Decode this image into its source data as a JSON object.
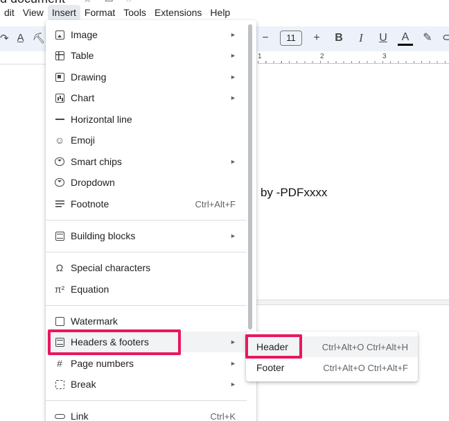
{
  "window": {
    "doc_title": "d document"
  },
  "menubar": {
    "items": [
      "dit",
      "View",
      "Insert",
      "Format",
      "Tools",
      "Extensions",
      "Help"
    ],
    "active": "Insert"
  },
  "toolbar": {
    "font_size": "11",
    "minus": "−",
    "plus": "+",
    "bold": "B",
    "italic": "I",
    "underline": "U",
    "text_color": "A"
  },
  "ruler": {
    "marks": [
      "1",
      "2",
      "3"
    ]
  },
  "document": {
    "visible_text": "by -PDFxxxx"
  },
  "insert_menu": {
    "items": [
      {
        "label": "Image",
        "icon": "image-icon",
        "submenu": true
      },
      {
        "label": "Table",
        "icon": "table-icon",
        "submenu": true
      },
      {
        "label": "Drawing",
        "icon": "drawing-icon",
        "submenu": true
      },
      {
        "label": "Chart",
        "icon": "chart-icon",
        "submenu": true
      },
      {
        "label": "Horizontal line",
        "icon": "horizontal-line-icon",
        "submenu": false
      },
      {
        "label": "Emoji",
        "icon": "emoji-icon",
        "submenu": false
      },
      {
        "label": "Smart chips",
        "icon": "smart-chips-icon",
        "submenu": true
      },
      {
        "label": "Dropdown",
        "icon": "dropdown-icon",
        "submenu": false
      },
      {
        "label": "Footnote",
        "icon": "footnote-icon",
        "shortcut": "Ctrl+Alt+F"
      },
      {
        "label": "Building blocks",
        "icon": "building-blocks-icon",
        "submenu": true
      },
      {
        "label": "Special characters",
        "icon": "omega-icon",
        "glyph": "Ω"
      },
      {
        "label": "Equation",
        "icon": "pi-icon",
        "glyph": "π²"
      },
      {
        "label": "Watermark",
        "icon": "watermark-icon"
      },
      {
        "label": "Headers & footers",
        "icon": "headers-footers-icon",
        "submenu": true,
        "highlighted": true
      },
      {
        "label": "Page numbers",
        "icon": "hash-icon",
        "glyph": "#",
        "submenu": true
      },
      {
        "label": "Break",
        "icon": "break-icon",
        "submenu": true
      },
      {
        "label": "Link",
        "icon": "link-icon",
        "shortcut": "Ctrl+K"
      }
    ]
  },
  "headers_submenu": {
    "items": [
      {
        "label": "Header",
        "shortcut": "Ctrl+Alt+O Ctrl+Alt+H",
        "highlighted": true
      },
      {
        "label": "Footer",
        "shortcut": "Ctrl+Alt+O Ctrl+Alt+F"
      }
    ]
  },
  "colors": {
    "highlight_box": "#e8175d",
    "toolbar_bg": "#edf2fa",
    "menu_hover": "#f1f3f4"
  }
}
